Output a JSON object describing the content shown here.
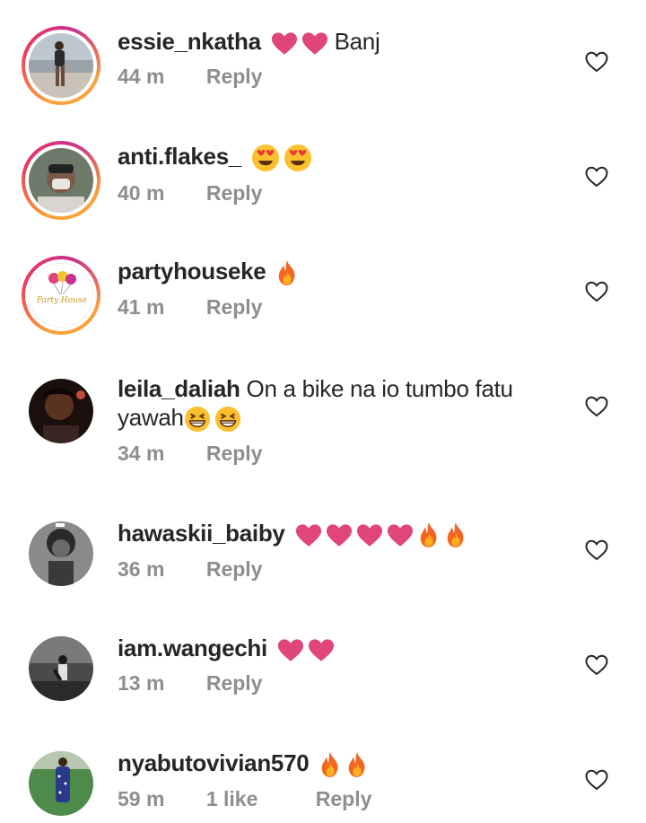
{
  "comments": [
    {
      "username": "essie_nkatha",
      "text": "Banj",
      "time": "44 m",
      "reply": "Reply"
    },
    {
      "username": "anti.flakes_",
      "text": "",
      "time": "40 m",
      "reply": "Reply"
    },
    {
      "username": "partyhouseke",
      "text": "",
      "time": "41 m",
      "reply": "Reply",
      "avatar_text": "Party House"
    },
    {
      "username": "leila_daliah",
      "text": "On a bike na io tumbo fatu",
      "text2": "yawah",
      "time": "34 m",
      "reply": "Reply"
    },
    {
      "username": "hawaskii_baiby",
      "text": "",
      "time": "36 m",
      "reply": "Reply"
    },
    {
      "username": "iam.wangechi",
      "text": "",
      "time": "13 m",
      "reply": "Reply"
    },
    {
      "username": "nyabutovivian570",
      "text": "",
      "time": "59 m",
      "likes": "1 like",
      "reply": "Reply"
    }
  ],
  "icons": {
    "like": "heart-outline-icon",
    "pink_heart": "pink-heart-emoji",
    "fire": "fire-emoji",
    "heart_eyes": "heart-eyes-emoji",
    "grin": "grinning-squint-emoji"
  },
  "colors": {
    "pink_heart": "#e0457b",
    "story_ring": "#e1306c",
    "meta": "#8e8e8e",
    "fire": "#f7931e"
  }
}
